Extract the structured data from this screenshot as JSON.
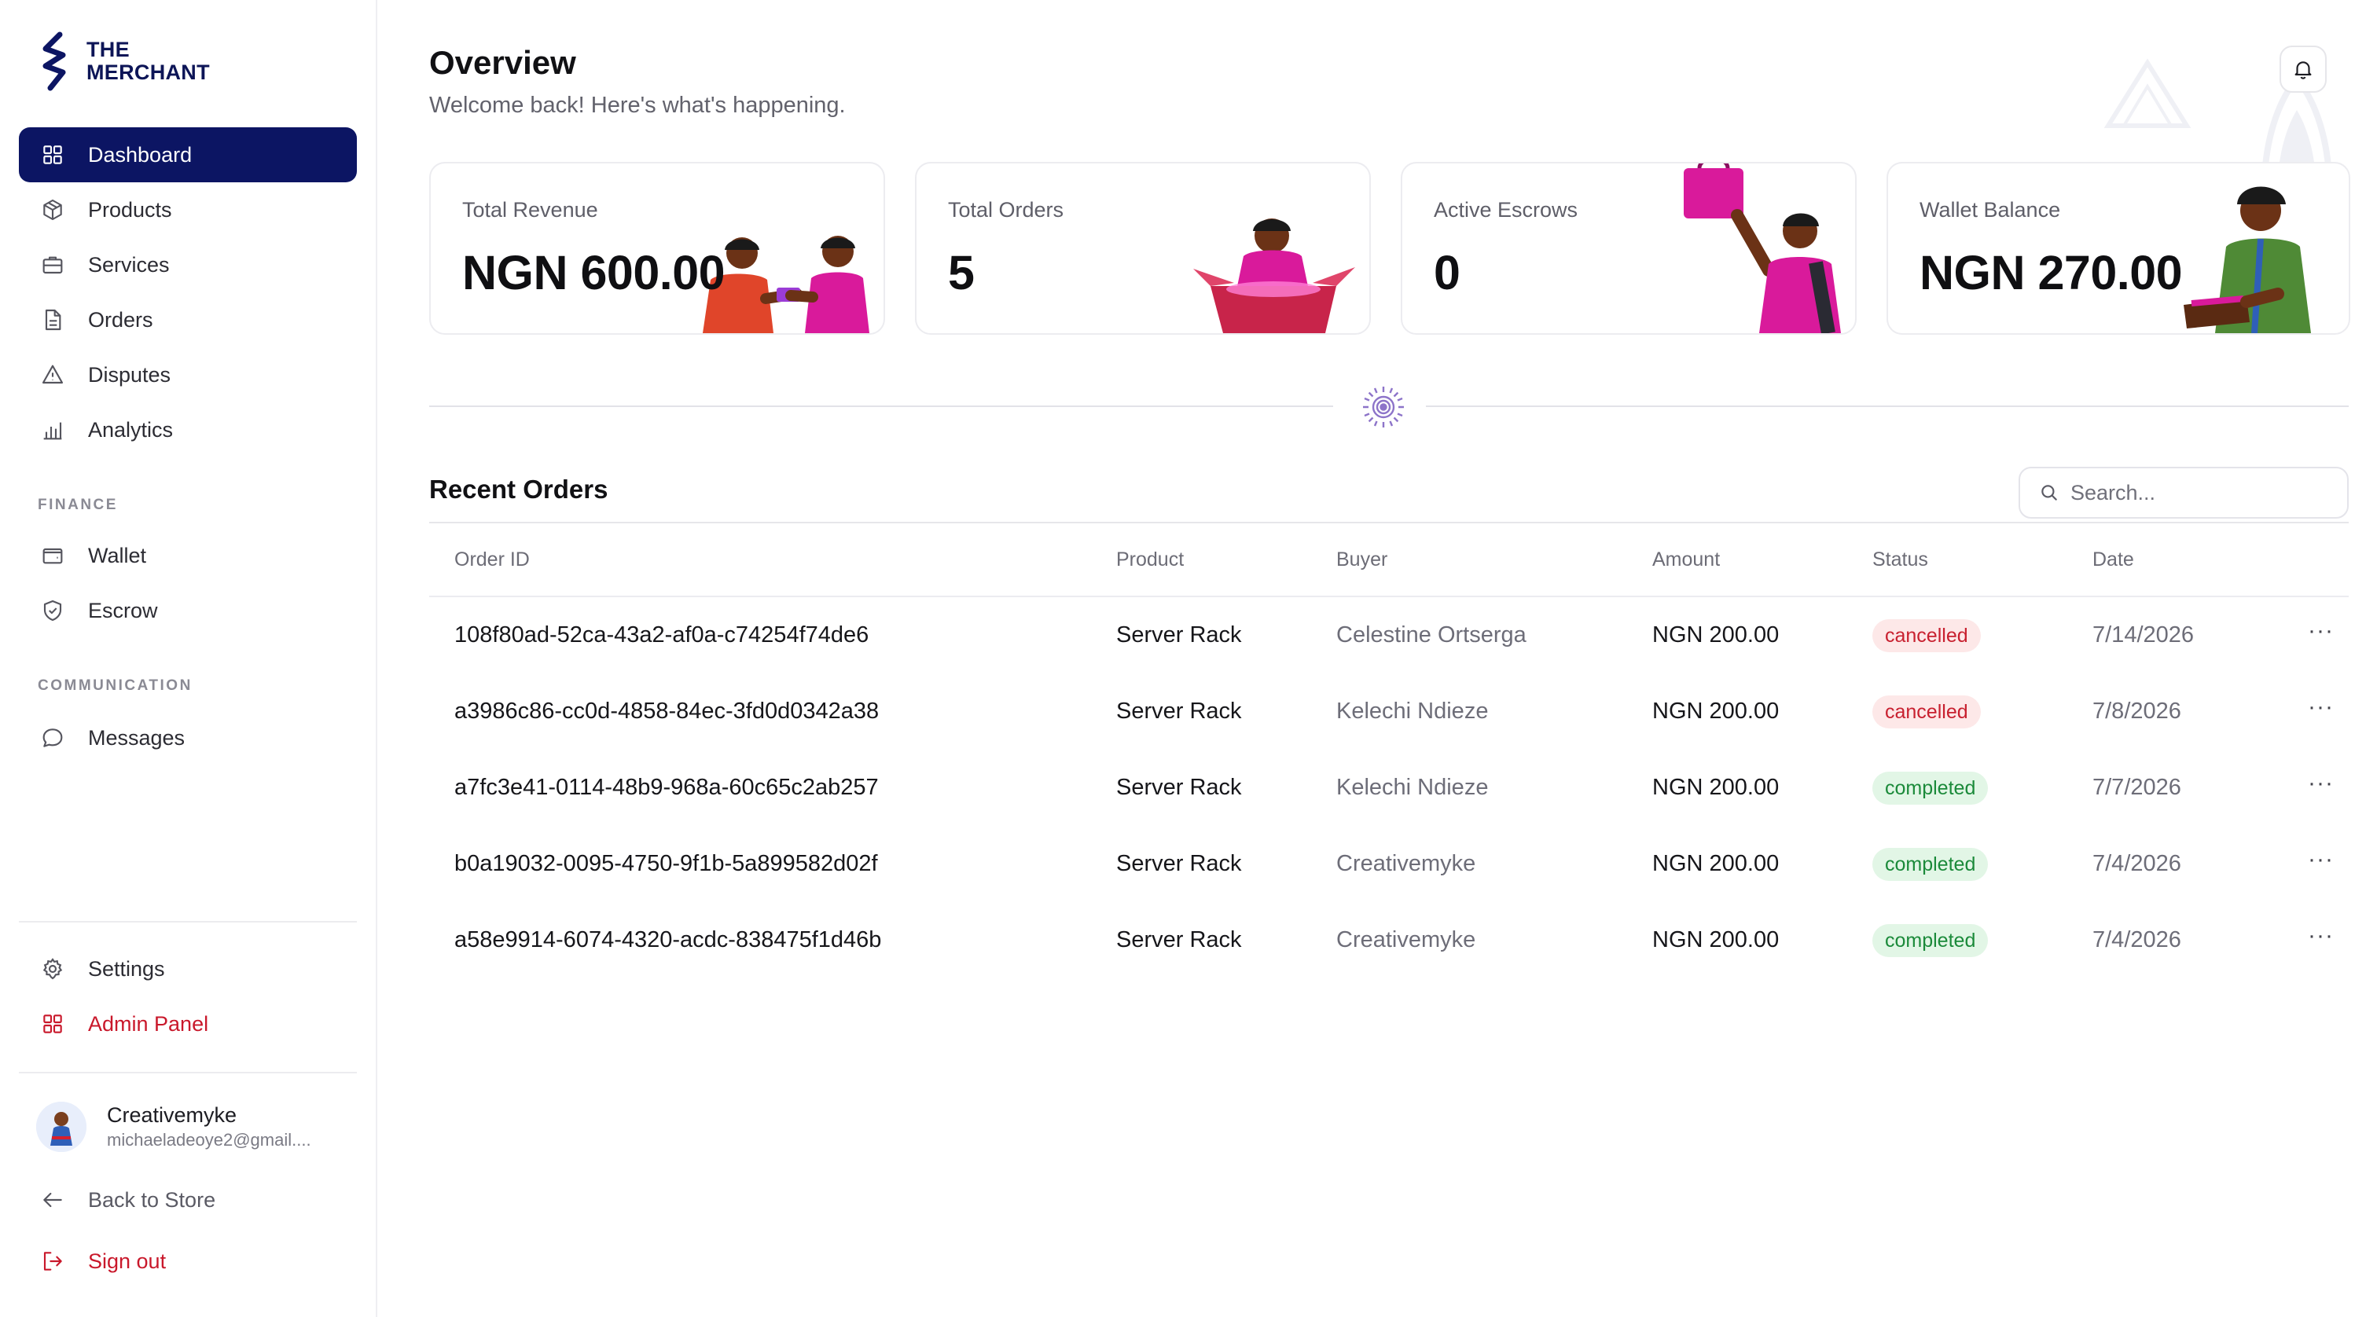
{
  "brand": {
    "line1": "THE",
    "line2": "MERCHANT",
    "color": "#0c1563"
  },
  "nav": {
    "dashboard": "Dashboard",
    "products": "Products",
    "services": "Services",
    "orders": "Orders",
    "disputes": "Disputes",
    "analytics": "Analytics",
    "finance_label": "FINANCE",
    "wallet": "Wallet",
    "escrow": "Escrow",
    "communication_label": "COMMUNICATION",
    "messages": "Messages",
    "settings": "Settings",
    "admin_panel": "Admin Panel",
    "back_to_store": "Back to Store",
    "sign_out": "Sign out",
    "active": "Dashboard"
  },
  "user": {
    "name": "Creativemyke",
    "email": "michaeladeoye2@gmail...."
  },
  "header": {
    "title": "Overview",
    "subtitle": "Welcome back! Here's what's happening.",
    "notification_icon": "bell-icon"
  },
  "stats": [
    {
      "label": "Total Revenue",
      "value": "NGN 600.00"
    },
    {
      "label": "Total Orders",
      "value": "5"
    },
    {
      "label": "Active Escrows",
      "value": "0"
    },
    {
      "label": "Wallet Balance",
      "value": "NGN 270.00"
    }
  ],
  "recent_orders": {
    "title": "Recent Orders",
    "search_placeholder": "Search...",
    "columns": [
      "Order ID",
      "Product",
      "Buyer",
      "Amount",
      "Status",
      "Date"
    ],
    "rows": [
      {
        "id": "108f80ad-52ca-43a2-af0a-c74254f74de6",
        "product": "Server Rack",
        "buyer": "Celestine Ortserga",
        "amount": "NGN 200.00",
        "status": "cancelled",
        "date": "7/14/2026",
        "actions": "···"
      },
      {
        "id": "a3986c86-cc0d-4858-84ec-3fd0d0342a38",
        "product": "Server Rack",
        "buyer": "Kelechi Ndieze",
        "amount": "NGN 200.00",
        "status": "cancelled",
        "date": "7/8/2026",
        "actions": "···"
      },
      {
        "id": "a7fc3e41-0114-48b9-968a-60c65c2ab257",
        "product": "Server Rack",
        "buyer": "Kelechi Ndieze",
        "amount": "NGN 200.00",
        "status": "completed",
        "date": "7/7/2026",
        "actions": "···"
      },
      {
        "id": "b0a19032-0095-4750-9f1b-5a899582d02f",
        "product": "Server Rack",
        "buyer": "Creativemyke",
        "amount": "NGN 200.00",
        "status": "completed",
        "date": "7/4/2026",
        "actions": "···"
      },
      {
        "id": "a58e9914-6074-4320-acdc-838475f1d46b",
        "product": "Server Rack",
        "buyer": "Creativemyke",
        "amount": "NGN 200.00",
        "status": "completed",
        "date": "7/4/2026",
        "actions": "···"
      }
    ]
  },
  "colors": {
    "primary": "#0c1563",
    "danger": "#c9182b",
    "cancelled_bg": "#fde8e8",
    "cancelled_text": "#c8202f",
    "completed_bg": "#e2f6e6",
    "completed_text": "#1b8a3a",
    "accent_magenta": "#d91a9b"
  }
}
